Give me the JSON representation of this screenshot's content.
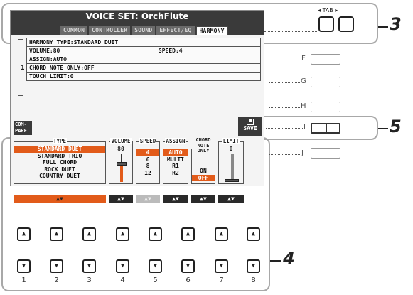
{
  "screen": {
    "title": "VOICE SET: OrchFlute",
    "tabs": [
      {
        "label": "COMMON",
        "active": false
      },
      {
        "label": "CONTROLLER",
        "active": false
      },
      {
        "label": "SOUND",
        "active": false
      },
      {
        "label": "EFFECT/EQ",
        "active": false
      },
      {
        "label": "HARMONY",
        "active": true
      }
    ],
    "params": {
      "harmony_type": "HARMONY TYPE:STANDARD DUET",
      "volume": "VOLUME:80",
      "speed": "SPEED:4",
      "row_number": "1",
      "assign": "ASSIGN:AUTO",
      "chord_note_only": "CHORD NOTE ONLY:OFF",
      "touch_limit": "TOUCH LIMIT:0"
    },
    "compare_label": "COM-\nPARE",
    "save_label": "SAVE"
  },
  "panel": {
    "type": {
      "title": "TYPE",
      "options": [
        "STANDARD DUET",
        "STANDARD TRIO",
        "FULL CHORD",
        "ROCK DUET",
        "COUNTRY DUET"
      ],
      "selected": 0
    },
    "volume": {
      "title": "VOLUME",
      "value": "80",
      "level": 0.63
    },
    "speed": {
      "title": "SPEED",
      "options": [
        "4",
        "6",
        "8",
        "12"
      ],
      "selected": 0
    },
    "assign": {
      "title": "ASSIGN",
      "options": [
        "AUTO",
        "MULTI",
        "R1",
        "R2"
      ],
      "selected": 0
    },
    "chord_note_only": {
      "title_lines": [
        "CHORD",
        "NOTE",
        "ONLY"
      ],
      "options": [
        "ON",
        "OFF"
      ],
      "selected": 1
    },
    "limit": {
      "title": "LIMIT",
      "value": "0",
      "level": 0.0
    },
    "arrow_glyph": "▲▼",
    "type_arrow_glyph": "▲▼"
  },
  "tab_control": {
    "label": "TAB",
    "left_glyph": "◂",
    "right_glyph": "▸"
  },
  "side_buttons": [
    "F",
    "G",
    "H",
    "I",
    "J"
  ],
  "callouts": [
    "3",
    "5",
    "4"
  ],
  "bottom_buttons": {
    "up_glyph": "▲",
    "down_glyph": "▼",
    "numbers": [
      "1",
      "2",
      "3",
      "4",
      "5",
      "6",
      "7",
      "8"
    ]
  },
  "colors": {
    "accent": "#e25b1a",
    "lcd_dark": "#3a3a3a"
  }
}
